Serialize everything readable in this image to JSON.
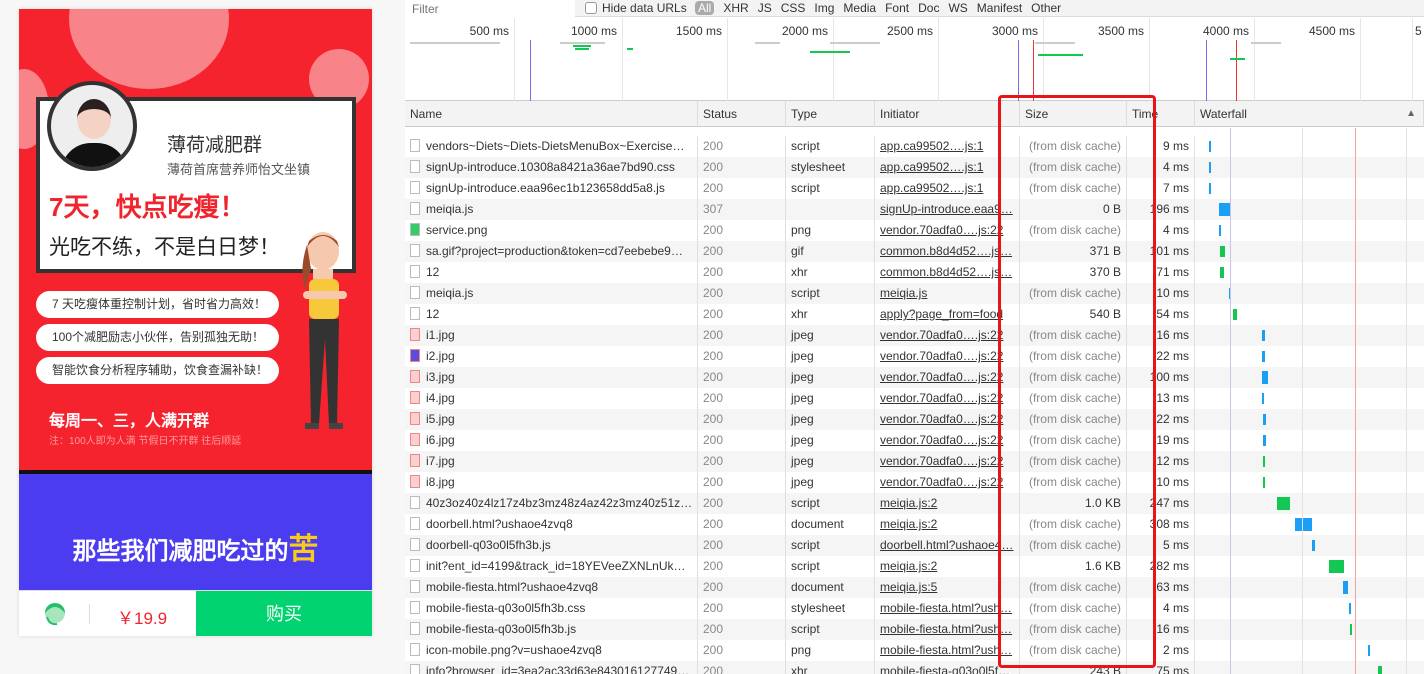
{
  "mobile": {
    "card_title": "薄荷减肥群",
    "card_subtitle": "薄荷首席营养师怡文坐镇",
    "headline": "7天，快点吃瘦！",
    "subheadline": "光吃不练，不是白日梦！",
    "pills": [
      "7 天吃瘦体重控制计划，省时省力高效！",
      "100个减肥励志小伙伴，告别孤独无助！",
      "智能饮食分析程序辅助，饮食查漏补缺！"
    ],
    "weekly": "每周一、三，人满开群",
    "note": "注：100人即为人满 节假日不开群 往后顺延",
    "banner_pre": "那些我们减肥吃过的",
    "banner_hl": "苦",
    "price": "￥19.9",
    "buy_label": "购买"
  },
  "devtools": {
    "filter_placeholder": "Filter",
    "hide_data_urls": "Hide data URLs",
    "types": [
      "All",
      "XHR",
      "JS",
      "CSS",
      "Img",
      "Media",
      "Font",
      "Doc",
      "WS",
      "Manifest",
      "Other"
    ],
    "overview_ticks": [
      "500 ms",
      "1000 ms",
      "1500 ms",
      "2000 ms",
      "2500 ms",
      "3000 ms",
      "3500 ms",
      "4000 ms",
      "4500 ms",
      "5"
    ],
    "columns": [
      "Name",
      "Status",
      "Type",
      "Initiator",
      "Size",
      "Time",
      "Waterfall"
    ],
    "colors": {
      "blue": "#1a9ff5",
      "green": "#12c752",
      "highlight": "#e8141a"
    },
    "rows": [
      {
        "name": "vendors~Diets~Diets-DietsMenuBox~Exercise…",
        "status": "200",
        "type": "script",
        "initiator": "app.ca99502….js:1",
        "size": "(from disk cache)",
        "time": "9 ms",
        "bar": "blue"
      },
      {
        "name": "signUp-introduce.10308a8421a36ae7bd90.css",
        "status": "200",
        "type": "stylesheet",
        "initiator": "app.ca99502….js:1",
        "size": "(from disk cache)",
        "time": "4 ms",
        "bar": "blue"
      },
      {
        "name": "signUp-introduce.eaa96ec1b123658dd5a8.js",
        "status": "200",
        "type": "script",
        "initiator": "app.ca99502….js:1",
        "size": "(from disk cache)",
        "time": "7 ms",
        "bar": "blue"
      },
      {
        "name": "meiqia.js",
        "status": "307",
        "type": "",
        "initiator": "signUp-introduce.eaa9…",
        "size": "0 B",
        "time": "196 ms",
        "bar": "blue"
      },
      {
        "name": "service.png",
        "status": "200",
        "type": "png",
        "initiator": "vendor.70adfa0….js:22",
        "size": "(from disk cache)",
        "time": "4 ms",
        "bar": "blue"
      },
      {
        "name": "sa.gif?project=production&token=cd7eebebe9…",
        "status": "200",
        "type": "gif",
        "initiator": "common.b8d4d52….js…",
        "size": "371 B",
        "time": "101 ms",
        "bar": "green"
      },
      {
        "name": "12",
        "status": "200",
        "type": "xhr",
        "initiator": "common.b8d4d52….js…",
        "size": "370 B",
        "time": "71 ms",
        "bar": "green"
      },
      {
        "name": "meiqia.js",
        "status": "200",
        "type": "script",
        "initiator": "meiqia.js",
        "size": "(from disk cache)",
        "time": "10 ms",
        "bar": "blue"
      },
      {
        "name": "12",
        "status": "200",
        "type": "xhr",
        "initiator": "apply?page_from=food",
        "size": "540 B",
        "time": "54 ms",
        "bar": "green"
      },
      {
        "name": "i1.jpg",
        "status": "200",
        "type": "jpeg",
        "initiator": "vendor.70adfa0….js:22",
        "size": "(from disk cache)",
        "time": "16 ms",
        "bar": "blue"
      },
      {
        "name": "i2.jpg",
        "status": "200",
        "type": "jpeg",
        "initiator": "vendor.70adfa0….js:22",
        "size": "(from disk cache)",
        "time": "22 ms",
        "bar": "blue"
      },
      {
        "name": "i3.jpg",
        "status": "200",
        "type": "jpeg",
        "initiator": "vendor.70adfa0….js:22",
        "size": "(from disk cache)",
        "time": "100 ms",
        "bar": "blue"
      },
      {
        "name": "i4.jpg",
        "status": "200",
        "type": "jpeg",
        "initiator": "vendor.70adfa0….js:22",
        "size": "(from disk cache)",
        "time": "13 ms",
        "bar": "blue"
      },
      {
        "name": "i5.jpg",
        "status": "200",
        "type": "jpeg",
        "initiator": "vendor.70adfa0….js:22",
        "size": "(from disk cache)",
        "time": "22 ms",
        "bar": "blue"
      },
      {
        "name": "i6.jpg",
        "status": "200",
        "type": "jpeg",
        "initiator": "vendor.70adfa0….js:22",
        "size": "(from disk cache)",
        "time": "19 ms",
        "bar": "blue"
      },
      {
        "name": "i7.jpg",
        "status": "200",
        "type": "jpeg",
        "initiator": "vendor.70adfa0….js:22",
        "size": "(from disk cache)",
        "time": "12 ms",
        "bar": "green"
      },
      {
        "name": "i8.jpg",
        "status": "200",
        "type": "jpeg",
        "initiator": "vendor.70adfa0….js:22",
        "size": "(from disk cache)",
        "time": "10 ms",
        "bar": "green"
      },
      {
        "name": "40z3oz40z4lz17z4bz3mz48z4az42z3mz40z51z…",
        "status": "200",
        "type": "script",
        "initiator": "meiqia.js:2",
        "size": "1.0 KB",
        "time": "247 ms",
        "bar": "green"
      },
      {
        "name": "doorbell.html?ushaoe4zvq8",
        "status": "200",
        "type": "document",
        "initiator": "meiqia.js:2",
        "size": "(from disk cache)",
        "time": "308 ms",
        "bar": "blue"
      },
      {
        "name": "doorbell-q03o0l5fh3b.js",
        "status": "200",
        "type": "script",
        "initiator": "doorbell.html?ushaoe4…",
        "size": "(from disk cache)",
        "time": "5 ms",
        "bar": "blue"
      },
      {
        "name": "init?ent_id=4199&track_id=18YEVeeZXNLnUk…",
        "status": "200",
        "type": "script",
        "initiator": "meiqia.js:2",
        "size": "1.6 KB",
        "time": "282 ms",
        "bar": "green"
      },
      {
        "name": "mobile-fiesta.html?ushaoe4zvq8",
        "status": "200",
        "type": "document",
        "initiator": "meiqia.js:5",
        "size": "(from disk cache)",
        "time": "63 ms",
        "bar": "blue"
      },
      {
        "name": "mobile-fiesta-q03o0l5fh3b.css",
        "status": "200",
        "type": "stylesheet",
        "initiator": "mobile-fiesta.html?ush…",
        "size": "(from disk cache)",
        "time": "4 ms",
        "bar": "blue"
      },
      {
        "name": "mobile-fiesta-q03o0l5fh3b.js",
        "status": "200",
        "type": "script",
        "initiator": "mobile-fiesta.html?ush…",
        "size": "(from disk cache)",
        "time": "16 ms",
        "bar": "green"
      },
      {
        "name": "icon-mobile.png?v=ushaoe4zvq8",
        "status": "200",
        "type": "png",
        "initiator": "mobile-fiesta.html?ush…",
        "size": "(from disk cache)",
        "time": "2 ms",
        "bar": "blue"
      },
      {
        "name": "info?browser_id=3ea2ac33d63e843016127749…",
        "status": "200",
        "type": "xhr",
        "initiator": "mobile-fiesta-q03o0l5f…",
        "size": "243 B",
        "time": "75 ms",
        "bar": "green"
      }
    ]
  }
}
